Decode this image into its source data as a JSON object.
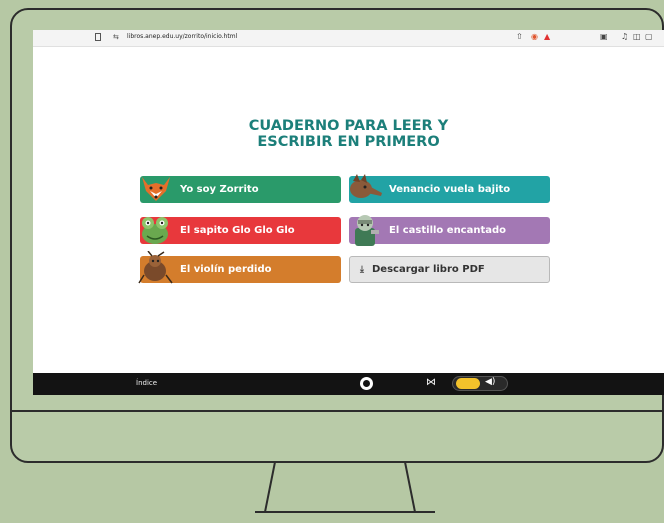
{
  "browser": {
    "url": "libros.anep.edu.uy/zorrito/inicio.html"
  },
  "page": {
    "title_line1": "CUADERNO PARA LEER Y",
    "title_line2": "ESCRIBIR EN PRIMERO"
  },
  "books": [
    {
      "label": "Yo soy Zorrito",
      "color": "#2a9a6a"
    },
    {
      "label": "Venancio vuela bajito",
      "color": "#22a3a5"
    },
    {
      "label": "El sapito Glo Glo Glo",
      "color": "#e8383c"
    },
    {
      "label": "El castillo encantado",
      "color": "#a378b4"
    },
    {
      "label": "El violín perdido",
      "color": "#d47d2c"
    }
  ],
  "download": {
    "label": "Descargar libro PDF",
    "icon": "download-icon"
  },
  "bottom_bar": {
    "index_label": "Índice"
  }
}
